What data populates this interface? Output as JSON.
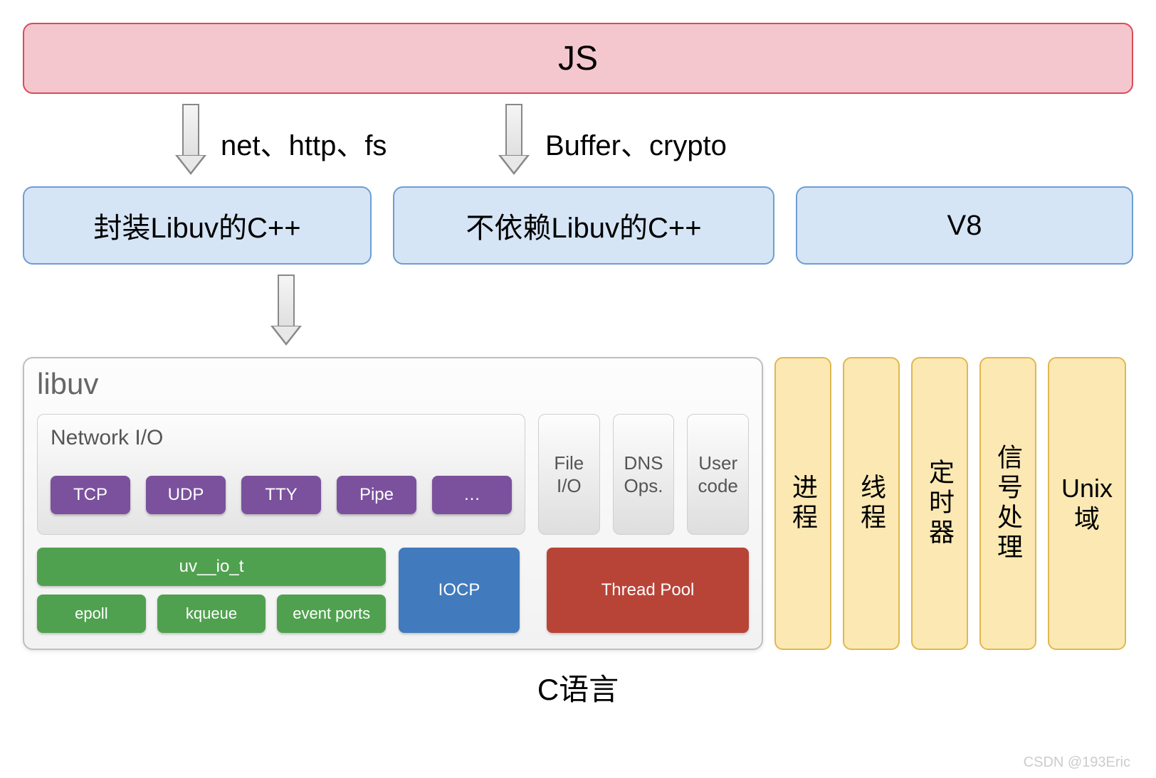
{
  "top": {
    "label": "JS"
  },
  "arrows": {
    "left_label": "net、http、fs",
    "right_label": "Buffer、crypto"
  },
  "mid": {
    "box1": "封装Libuv的C++",
    "box2": "不依赖Libuv的C++",
    "box3": "V8"
  },
  "libuv": {
    "title": "libuv",
    "network_io_title": "Network I/O",
    "purple": [
      "TCP",
      "UDP",
      "TTY",
      "Pipe",
      "…"
    ],
    "small_grey": [
      "File\nI/O",
      "DNS\nOps.",
      "User\ncode"
    ],
    "green_wide": "uv__io_t",
    "green_small": [
      "epoll",
      "kqueue",
      "event ports"
    ],
    "blue": "IOCP",
    "red": "Thread Pool"
  },
  "yellow": [
    "进程",
    "线程",
    "定时器",
    "信号处理",
    "Unix\n域"
  ],
  "footer": "C语言",
  "watermark": "CSDN @193Eric"
}
